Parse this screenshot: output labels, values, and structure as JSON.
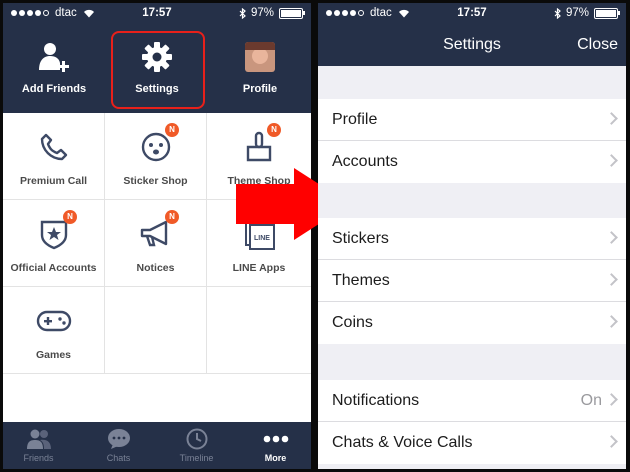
{
  "left": {
    "status": {
      "carrier": "dtac",
      "time": "17:57",
      "battery": "97%"
    },
    "top_nav": [
      {
        "label": "Add Friends",
        "icon": "add-friend-icon"
      },
      {
        "label": "Settings",
        "icon": "gear-icon",
        "highlighted": true
      },
      {
        "label": "Profile",
        "icon": "avatar"
      }
    ],
    "grid": [
      {
        "label": "Premium Call",
        "icon": "phone-icon",
        "badge": ""
      },
      {
        "label": "Sticker Shop",
        "icon": "sticker-icon",
        "badge": "N"
      },
      {
        "label": "Theme Shop",
        "icon": "brush-icon",
        "badge": "N"
      },
      {
        "label": "Official Accounts",
        "icon": "shield-star-icon",
        "badge": "N"
      },
      {
        "label": "Notices",
        "icon": "megaphone-icon",
        "badge": "N"
      },
      {
        "label": "LINE Apps",
        "icon": "line-apps-icon",
        "icon_text": "LINE",
        "badge": ""
      },
      {
        "label": "Games",
        "icon": "gamepad-icon",
        "badge": ""
      }
    ],
    "tabs": [
      {
        "label": "Friends",
        "icon": "friends-icon"
      },
      {
        "label": "Chats",
        "icon": "chat-bubble-icon"
      },
      {
        "label": "Timeline",
        "icon": "clock-icon"
      },
      {
        "label": "",
        "icon": ""
      },
      {
        "label": "More",
        "icon": "more-dots-icon",
        "active": true
      }
    ]
  },
  "right": {
    "status": {
      "carrier": "dtac",
      "time": "17:57",
      "battery": "97%"
    },
    "title": "Settings",
    "close": "Close",
    "groups": [
      [
        {
          "label": "Profile"
        },
        {
          "label": "Accounts"
        }
      ],
      [
        {
          "label": "Stickers"
        },
        {
          "label": "Themes"
        },
        {
          "label": "Coins"
        }
      ],
      [
        {
          "label": "Notifications",
          "value": "On"
        },
        {
          "label": "Chats & Voice Calls"
        }
      ]
    ]
  },
  "colors": {
    "navy": "#253048",
    "badge": "#f05a28",
    "arrow": "#ff0000",
    "highlight": "#e8201a"
  }
}
